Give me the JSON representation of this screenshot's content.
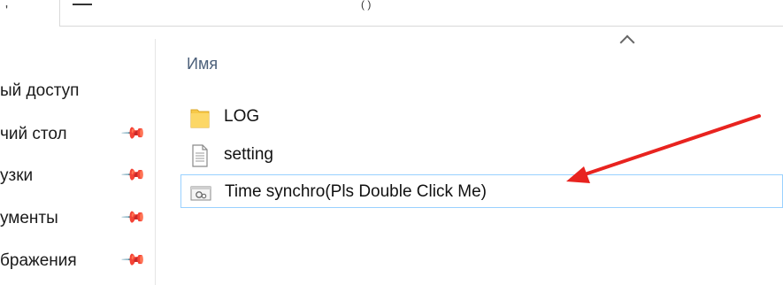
{
  "addressbar": {
    "path_glyph": "( )"
  },
  "sidebar": {
    "items": [
      {
        "label": "ый доступ",
        "pinned": false
      },
      {
        "label": "чий стол",
        "pinned": true
      },
      {
        "label": "узки",
        "pinned": true
      },
      {
        "label": "ументы",
        "pinned": true
      },
      {
        "label": "бражения",
        "pinned": true
      }
    ]
  },
  "content": {
    "column_header": "Имя",
    "files": [
      {
        "name": "LOG",
        "type": "folder-icon"
      },
      {
        "name": "setting",
        "type": "text-file-icon"
      },
      {
        "name": "Time synchro(Pls Double Click Me)",
        "type": "config-file-icon",
        "selected": true
      }
    ]
  },
  "colors": {
    "selection_border": "#99d1ff",
    "annotation_arrow": "#e8231f",
    "folder": "#f7c948"
  }
}
